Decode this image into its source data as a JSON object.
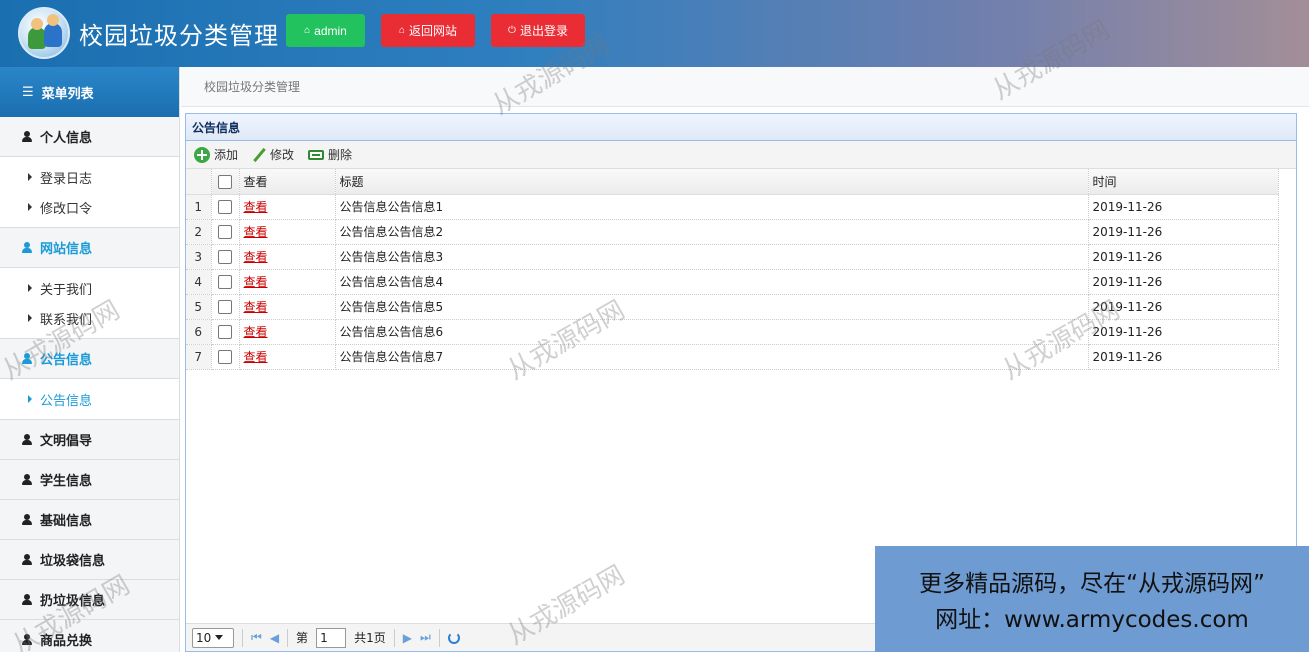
{
  "header": {
    "title": "校园垃圾分类管理",
    "user_button": "admin",
    "back_button": "返回网站",
    "logout_button": "退出登录"
  },
  "sidebar": {
    "menu_title": "菜单列表",
    "groups": [
      {
        "label": "个人信息",
        "items": [
          "登录日志",
          "修改口令"
        ]
      },
      {
        "label": "网站信息",
        "items": [
          "关于我们",
          "联系我们"
        ]
      },
      {
        "label": "公告信息",
        "items": [
          "公告信息"
        ]
      },
      {
        "label": "文明倡导"
      },
      {
        "label": "学生信息"
      },
      {
        "label": "基础信息"
      },
      {
        "label": "垃圾袋信息"
      },
      {
        "label": "扔垃圾信息"
      },
      {
        "label": "商品兑换"
      }
    ]
  },
  "breadcrumb": "校园垃圾分类管理",
  "panel": {
    "title": "公告信息",
    "toolbar": {
      "add": "添加",
      "edit": "修改",
      "delete": "删除"
    },
    "columns": {
      "view": "查看",
      "title": "标题",
      "time": "时间"
    },
    "rows": [
      {
        "n": "1",
        "view": "查看",
        "title": "公告信息公告信息1",
        "time": "2019-11-26"
      },
      {
        "n": "2",
        "view": "查看",
        "title": "公告信息公告信息2",
        "time": "2019-11-26"
      },
      {
        "n": "3",
        "view": "查看",
        "title": "公告信息公告信息3",
        "time": "2019-11-26"
      },
      {
        "n": "4",
        "view": "查看",
        "title": "公告信息公告信息4",
        "time": "2019-11-26"
      },
      {
        "n": "5",
        "view": "查看",
        "title": "公告信息公告信息5",
        "time": "2019-11-26"
      },
      {
        "n": "6",
        "view": "查看",
        "title": "公告信息公告信息6",
        "time": "2019-11-26"
      },
      {
        "n": "7",
        "view": "查看",
        "title": "公告信息公告信息7",
        "time": "2019-11-26"
      }
    ],
    "pager": {
      "page_size": "10",
      "page_label": "第",
      "page_value": "1",
      "total": "共1页"
    }
  },
  "watermark": "从戎源码网",
  "ad": {
    "line1": "更多精品源码，尽在“从戎源码网”",
    "line2": "网址：www.armycodes.com"
  },
  "colors": {
    "accent": "#1a9ad6",
    "header": "#1a6fb0",
    "green_button": "#22c35e",
    "red_button": "#ea2d34"
  }
}
